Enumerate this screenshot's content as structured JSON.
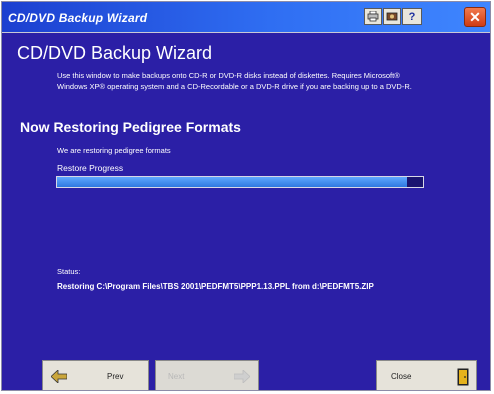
{
  "window": {
    "title": "CD/DVD Backup Wizard",
    "close_glyph": "✕",
    "toolbar_icons": [
      "printer-icon",
      "tools-icon",
      "help-icon"
    ],
    "help_glyph": "?"
  },
  "main": {
    "title": "CD/DVD Backup Wizard",
    "intro": "Use this window to make backups onto CD-R or DVD-R disks instead of diskettes. Requires Microsoft® Windows XP® operating system and a CD-Recordable or a DVD-R drive if you are backing up to a DVD-R."
  },
  "section": {
    "title": "Now Restoring Pedigree Formats",
    "sub_status": "We are restoring pedigree formats"
  },
  "progress": {
    "label": "Restore Progress",
    "fraction": 0.955
  },
  "status": {
    "label": "Status:",
    "text": "Restoring C:\\Program Files\\TBS 2001\\PEDFMT5\\PPP1.13.PPL from d:\\PEDFMT5.ZIP"
  },
  "buttons": {
    "prev": "Prev",
    "next": "Next",
    "close": "Close"
  },
  "colors": {
    "background": "#2b1fa6",
    "progress_fill": "#3b86f0",
    "titlebar": "#2f6ef2"
  }
}
